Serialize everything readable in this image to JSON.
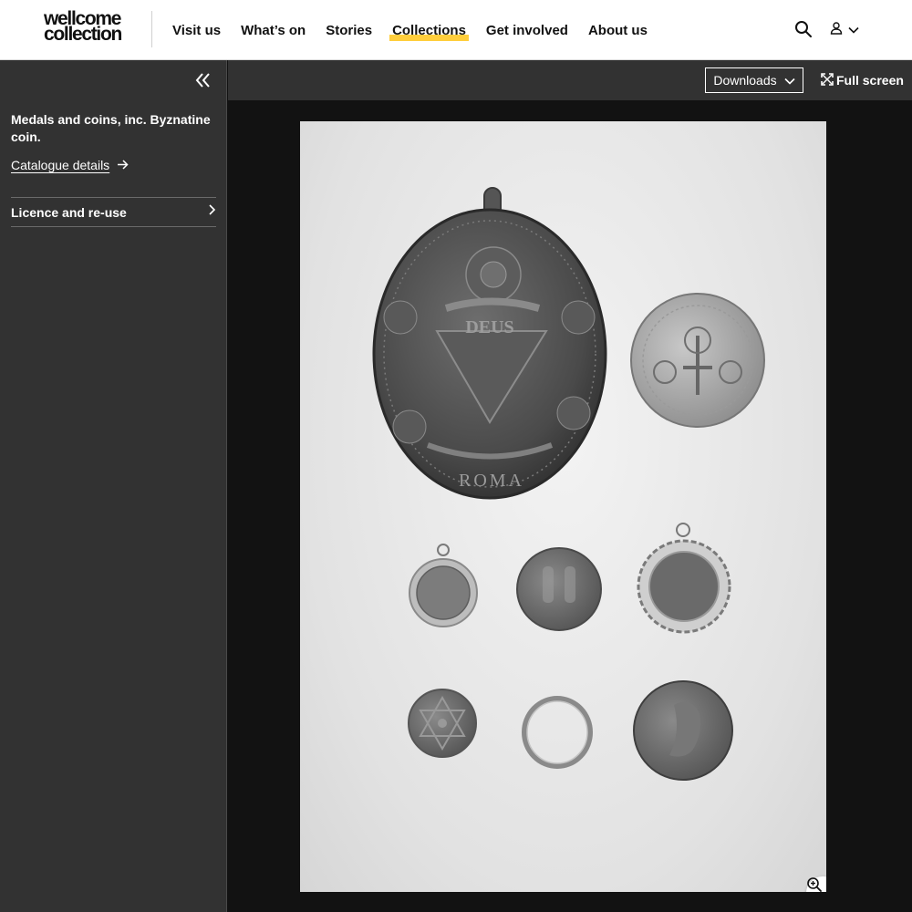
{
  "header": {
    "logo_line1": "wellcome",
    "logo_line2": "collection",
    "nav": [
      {
        "label": "Visit us",
        "active": false
      },
      {
        "label": "What’s on",
        "active": false
      },
      {
        "label": "Stories",
        "active": false
      },
      {
        "label": "Collections",
        "active": true
      },
      {
        "label": "Get involved",
        "active": false
      },
      {
        "label": "About us",
        "active": false
      }
    ],
    "search_icon": "search-icon",
    "account_icon": "user-icon"
  },
  "sidebar": {
    "item_title": "Medals and coins, inc. Byznatine coin.",
    "catalogue_link": "Catalogue details",
    "licence_label": "Licence and re-use"
  },
  "toolbar": {
    "downloads_label": "Downloads",
    "fullscreen_label": "Full screen"
  },
  "viewer": {
    "medal_inscription_top": "DEUS",
    "medal_inscription_bottom": "ROMA"
  },
  "colors": {
    "accent": "#ffce3c",
    "sidebar_bg": "#323232",
    "viewer_bg": "#121212"
  }
}
